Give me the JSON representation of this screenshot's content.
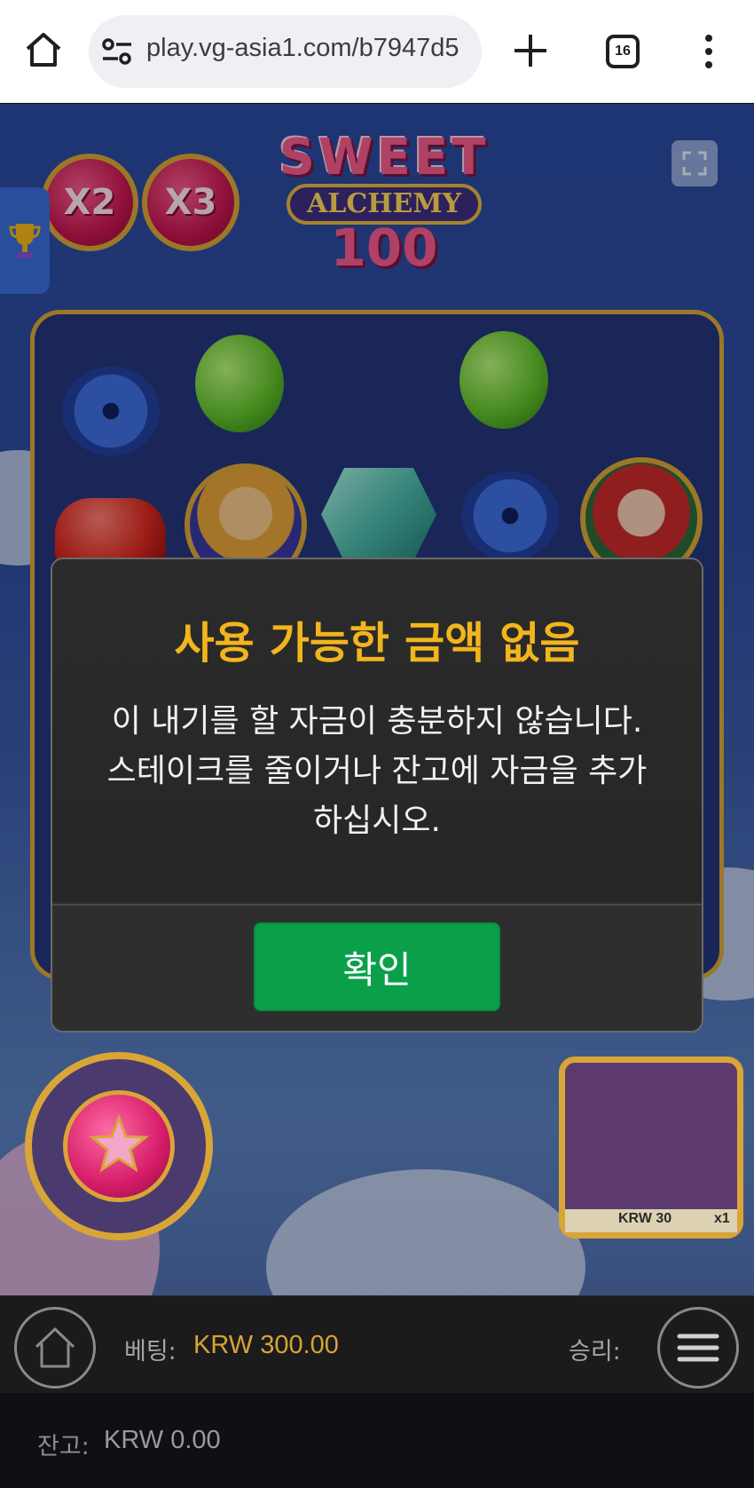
{
  "browser": {
    "url": "play.vg-asia1.com/b7947d5",
    "tab_count": "16"
  },
  "game": {
    "logo_line1": "SWEET",
    "logo_line2": "ALCHEMY",
    "logo_line3": "100",
    "multipliers": [
      "X2",
      "X3"
    ],
    "buy_panel": {
      "price": "KRW 30",
      "multiplier": "x1"
    }
  },
  "modal": {
    "title": "사용 가능한 금액 없음",
    "message_line1": "이 내기를 할 자금이 충분하지 않습니다.",
    "message_line2": "스테이크를 줄이거나 잔고에 자금을 추가",
    "message_line3": "하십시오.",
    "confirm_label": "확인"
  },
  "status_bar": {
    "bet_label": "베팅:",
    "bet_value": "KRW 300.00",
    "win_label": "승리:",
    "balance_label": "잔고:",
    "balance_value": "KRW 0.00"
  },
  "colors": {
    "modal_title": "#f2b51d",
    "confirm_button": "#0aa04a",
    "bet_value": "#d8a431"
  }
}
